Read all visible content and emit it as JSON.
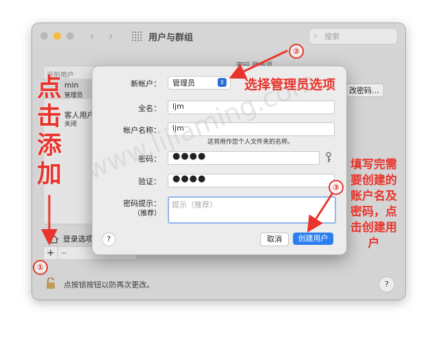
{
  "window": {
    "title": "用户与群组",
    "search_placeholder": "搜索",
    "nav_back": "‹",
    "nav_forward": "›"
  },
  "sidebar": {
    "section_current": "当前用户",
    "user_name": "min",
    "user_role": "管理员",
    "guest_name": "客人用户",
    "guest_status": "关闭",
    "login_options": "登录选项",
    "add_label": "+",
    "remove_label": "−"
  },
  "main": {
    "tabs_label": "密码   登录项",
    "change_password": "改密码…"
  },
  "footer": {
    "lock_text": "点按锁按钮以防再次更改。",
    "help": "?"
  },
  "dialog": {
    "account_label": "新帐户：",
    "account_value": "管理员",
    "fullname_label": "全名：",
    "fullname_value": "ljm",
    "accountname_label": "帐户名称：",
    "accountname_value": "ljm",
    "accountname_hint": "这将用作您个人文件夹的名称。",
    "password_label": "密码：",
    "password_value": "●●●●",
    "verify_label": "验证：",
    "verify_value": "●●●●",
    "hint_label": "密码提示：",
    "hint_sub": "（推荐）",
    "hint_placeholder": "提示（推荐）",
    "help": "?",
    "cancel": "取消",
    "create": "创建用户"
  },
  "annotations": {
    "step1": "①",
    "step2": "②",
    "step3": "③",
    "left_text": "点击添加",
    "top_text": "选择管理员选项",
    "right_text": "填写完需要创建的账户名及密码，点击创建用户",
    "watermark": "www.lijiaming.com"
  },
  "colors": {
    "annotation_red": "#e8342c",
    "primary_button": "#2a7ef0",
    "traffic_yellow": "#f5be41"
  }
}
